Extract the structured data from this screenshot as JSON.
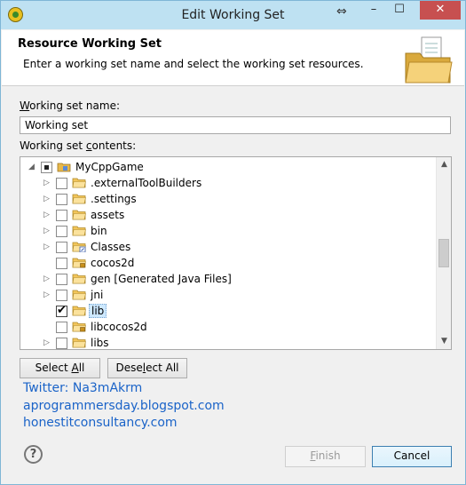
{
  "window": {
    "title": "Edit Working Set",
    "close_label": "✕",
    "min_label": "–",
    "max_label": "☐"
  },
  "header": {
    "title": "Resource Working Set",
    "description": "Enter a working set name and select the working set resources."
  },
  "form": {
    "name_label_u": "W",
    "name_label_rest": "orking set name:",
    "name_value": "Working set",
    "contents_label_pre": "Working set ",
    "contents_label_u": "c",
    "contents_label_rest": "ontents:"
  },
  "tree": {
    "items": [
      {
        "label": "MyCppGame",
        "level": 0,
        "expander": "expanded",
        "check": "partial",
        "icon": "project"
      },
      {
        "label": ".externalToolBuilders",
        "level": 1,
        "expander": "collapsed",
        "check": "unchecked",
        "icon": "folder"
      },
      {
        "label": ".settings",
        "level": 1,
        "expander": "collapsed",
        "check": "unchecked",
        "icon": "folder"
      },
      {
        "label": "assets",
        "level": 1,
        "expander": "collapsed",
        "check": "unchecked",
        "icon": "folder"
      },
      {
        "label": "bin",
        "level": 1,
        "expander": "collapsed",
        "check": "unchecked",
        "icon": "folder"
      },
      {
        "label": "Classes",
        "level": 1,
        "expander": "collapsed",
        "check": "unchecked",
        "icon": "folder-link"
      },
      {
        "label": "cocos2d",
        "level": 1,
        "expander": "none",
        "check": "unchecked",
        "icon": "folder-locked"
      },
      {
        "label": "gen [Generated Java Files]",
        "level": 1,
        "expander": "collapsed",
        "check": "unchecked",
        "icon": "folder"
      },
      {
        "label": "jni",
        "level": 1,
        "expander": "collapsed",
        "check": "unchecked",
        "icon": "folder"
      },
      {
        "label": "lib",
        "level": 1,
        "expander": "none",
        "check": "checked",
        "icon": "folder",
        "selected": true
      },
      {
        "label": "libcocos2d",
        "level": 1,
        "expander": "none",
        "check": "unchecked",
        "icon": "folder-locked"
      },
      {
        "label": "libs",
        "level": 1,
        "expander": "collapsed",
        "check": "unchecked",
        "icon": "folder"
      }
    ]
  },
  "buttons": {
    "select_all_pre": "Select ",
    "select_all_u": "A",
    "select_all_rest": "ll",
    "deselect_all_pre": "Dese",
    "deselect_all_u": "l",
    "deselect_all_rest": "ect All",
    "finish_u": "F",
    "finish_rest": "inish",
    "cancel": "Cancel"
  },
  "links": [
    "Twitter: Na3mAkrm",
    "aprogrammersday.blogspot.com",
    "honestitconsultancy.com"
  ],
  "help_symbol": "?",
  "colors": {
    "titlebar": "#bee1f2",
    "close": "#c75050",
    "link": "#1a63c8",
    "selection": "#cde8ff"
  }
}
